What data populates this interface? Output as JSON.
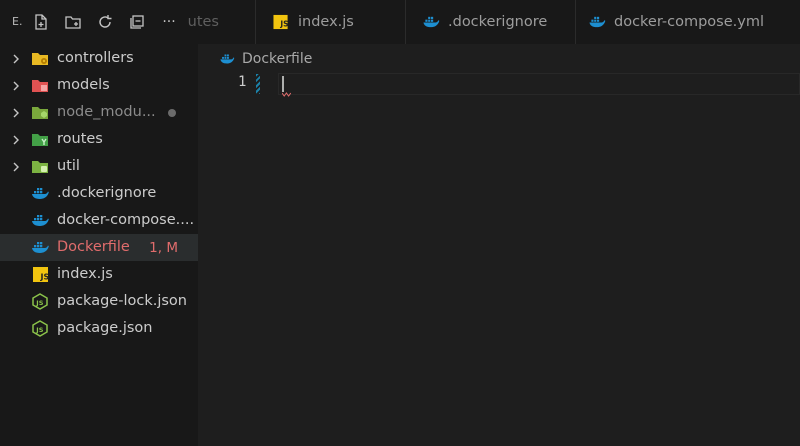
{
  "sidebar": {
    "title": "E.",
    "actions": [
      {
        "name": "new-file-icon"
      },
      {
        "name": "new-folder-icon"
      },
      {
        "name": "refresh-icon"
      },
      {
        "name": "collapse-all-icon"
      },
      {
        "name": "more-icon",
        "glyph": "···"
      }
    ],
    "items": [
      {
        "label": "controllers",
        "type": "folder",
        "icon": "folder-controllers-icon",
        "color": "#e8b923"
      },
      {
        "label": "models",
        "type": "folder",
        "icon": "folder-models-icon",
        "color": "#e05252"
      },
      {
        "label": "node_modu...",
        "type": "folder",
        "icon": "folder-node-icon",
        "color": "#8bc34a",
        "dimmed": true
      },
      {
        "label": "routes",
        "type": "folder",
        "icon": "folder-routes-icon",
        "color": "#43a047"
      },
      {
        "label": "util",
        "type": "folder",
        "icon": "folder-util-icon",
        "color": "#7cb342"
      },
      {
        "label": ".dockerignore",
        "type": "file",
        "icon": "docker-icon"
      },
      {
        "label": "docker-compose....",
        "type": "file",
        "icon": "docker-icon"
      },
      {
        "label": "Dockerfile",
        "type": "file",
        "icon": "docker-icon",
        "status": "1, M",
        "selected": true
      },
      {
        "label": "index.js",
        "type": "file",
        "icon": "js-icon",
        "color": "#f1c40f"
      },
      {
        "label": "package-lock.json",
        "type": "file",
        "icon": "nodejs-icon",
        "color": "#8bc34a"
      },
      {
        "label": "package.json",
        "type": "file",
        "icon": "nodejs-icon",
        "color": "#8bc34a"
      }
    ]
  },
  "tabs": [
    {
      "label": "utes",
      "partial": true
    },
    {
      "label": "index.js",
      "icon": "js-icon"
    },
    {
      "label": ".dockerignore",
      "icon": "docker-icon"
    },
    {
      "label": "docker-compose.yml",
      "icon": "docker-icon"
    }
  ],
  "editor": {
    "breadcrumb": "Dockerfile",
    "line_number": "1"
  },
  "colors": {
    "docker": "#1d8fd1",
    "error": "#e06c6c",
    "sidebar_bg": "#181818",
    "editor_bg": "#1e1e1e"
  }
}
